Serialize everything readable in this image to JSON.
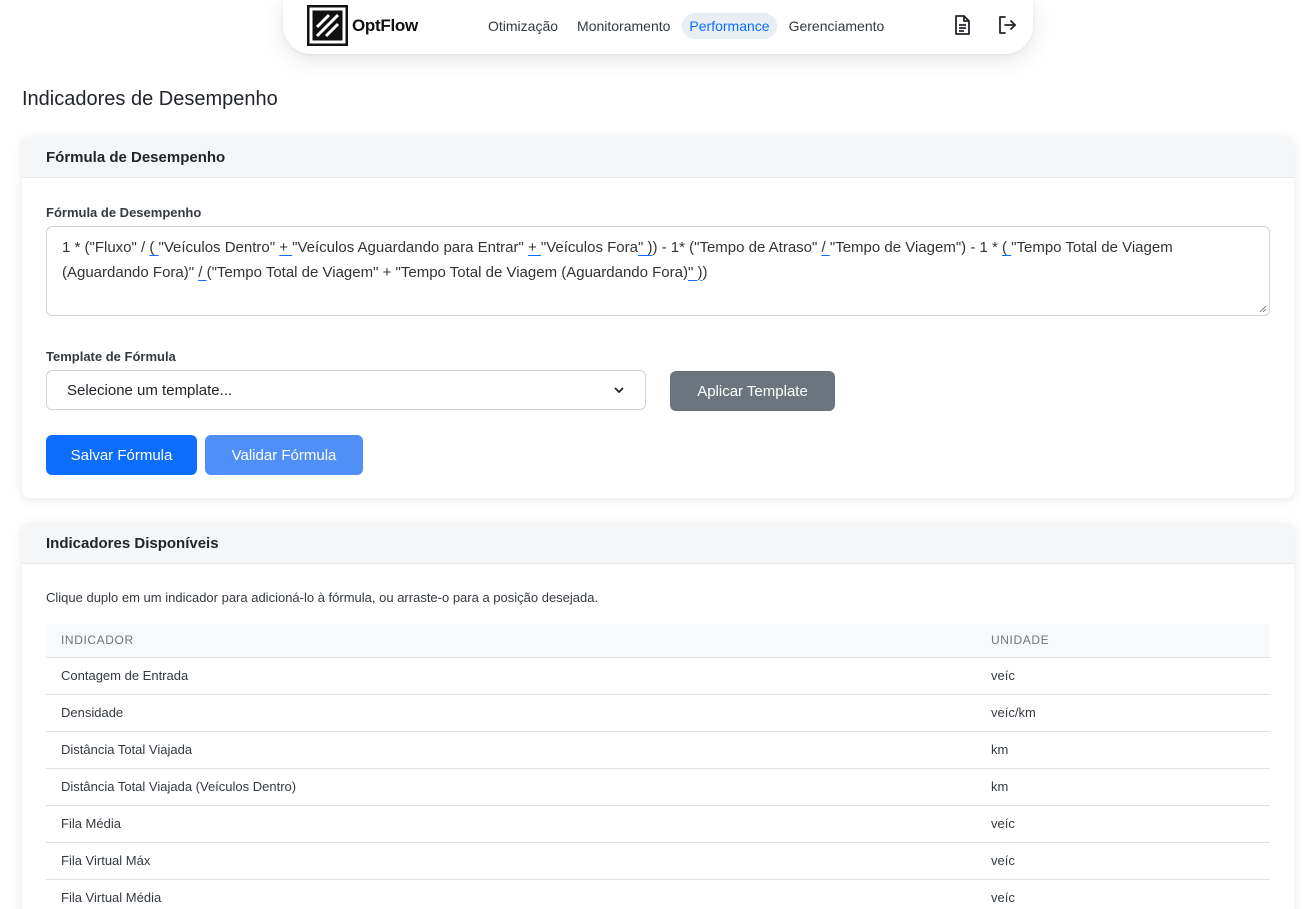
{
  "nav": {
    "brand": "OptFlow",
    "links": [
      "Otimização",
      "Monitoramento",
      "Performance",
      "Gerenciamento"
    ],
    "active": "Performance",
    "icons": [
      "document-icon",
      "logout-icon"
    ]
  },
  "page": {
    "title": "Indicadores de Desempenho"
  },
  "formula_card": {
    "header": "Fórmula de Desempenho",
    "field_label": "Fórmula de Desempenho",
    "formula_segments": [
      {
        "t": "1 * (\"Fluxo\" / ",
        "u": false
      },
      {
        "t": "( ",
        "u": true
      },
      {
        "t": "\"Veículos Dentro\" ",
        "u": false
      },
      {
        "t": "+  ",
        "u": true
      },
      {
        "t": "\"Veículos Aguardando para Entrar\" ",
        "u": false
      },
      {
        "t": "+  ",
        "u": true
      },
      {
        "t": "\"Veículos Fora",
        "u": false
      },
      {
        "t": "\" ",
        "u": true
      },
      {
        "t": ")",
        "u": true
      },
      {
        "t": ") - 1* (\"Tempo de Atraso\" ",
        "u": false
      },
      {
        "t": "/  ",
        "u": true
      },
      {
        "t": "\"Tempo de Viagem\") - 1 * ",
        "u": false
      },
      {
        "t": "( ",
        "u": true
      },
      {
        "t": "\"Tempo Total de Viagem (Aguardando Fora)\" ",
        "u": false
      },
      {
        "t": "/  ",
        "u": true
      },
      {
        "t": "(\"Tempo Total de Viagem\" + \"Tempo Total de Viagem (Aguardando Fora)",
        "u": false
      },
      {
        "t": "\" ",
        "u": true
      },
      {
        "t": ")",
        "u": true
      },
      {
        "t": ")",
        "u": false
      }
    ],
    "template_label": "Template de Fórmula",
    "template_placeholder": "Selecione um template...",
    "apply_template_label": "Aplicar Template",
    "save_label": "Salvar Fórmula",
    "validate_label": "Validar Fórmula"
  },
  "indicators_card": {
    "header": "Indicadores Disponíveis",
    "hint": "Clique duplo em um indicador para adicioná-lo à fórmula, ou arraste-o para a posição desejada.",
    "columns": [
      "INDICADOR",
      "UNIDADE"
    ],
    "rows": [
      {
        "name": "Contagem de Entrada",
        "unit": "veíc"
      },
      {
        "name": "Densidade",
        "unit": "veíc/km"
      },
      {
        "name": "Distância Total Viajada",
        "unit": "km"
      },
      {
        "name": "Distância Total Viajada (Veículos Dentro)",
        "unit": "km"
      },
      {
        "name": "Fila Média",
        "unit": "veíc"
      },
      {
        "name": "Fila Virtual Máx",
        "unit": "veíc"
      },
      {
        "name": "Fila Virtual Média",
        "unit": "veíc"
      }
    ]
  },
  "colors": {
    "primary": "#0d6efd",
    "secondary": "#6c757d",
    "active_nav_bg": "#e9eef5"
  }
}
